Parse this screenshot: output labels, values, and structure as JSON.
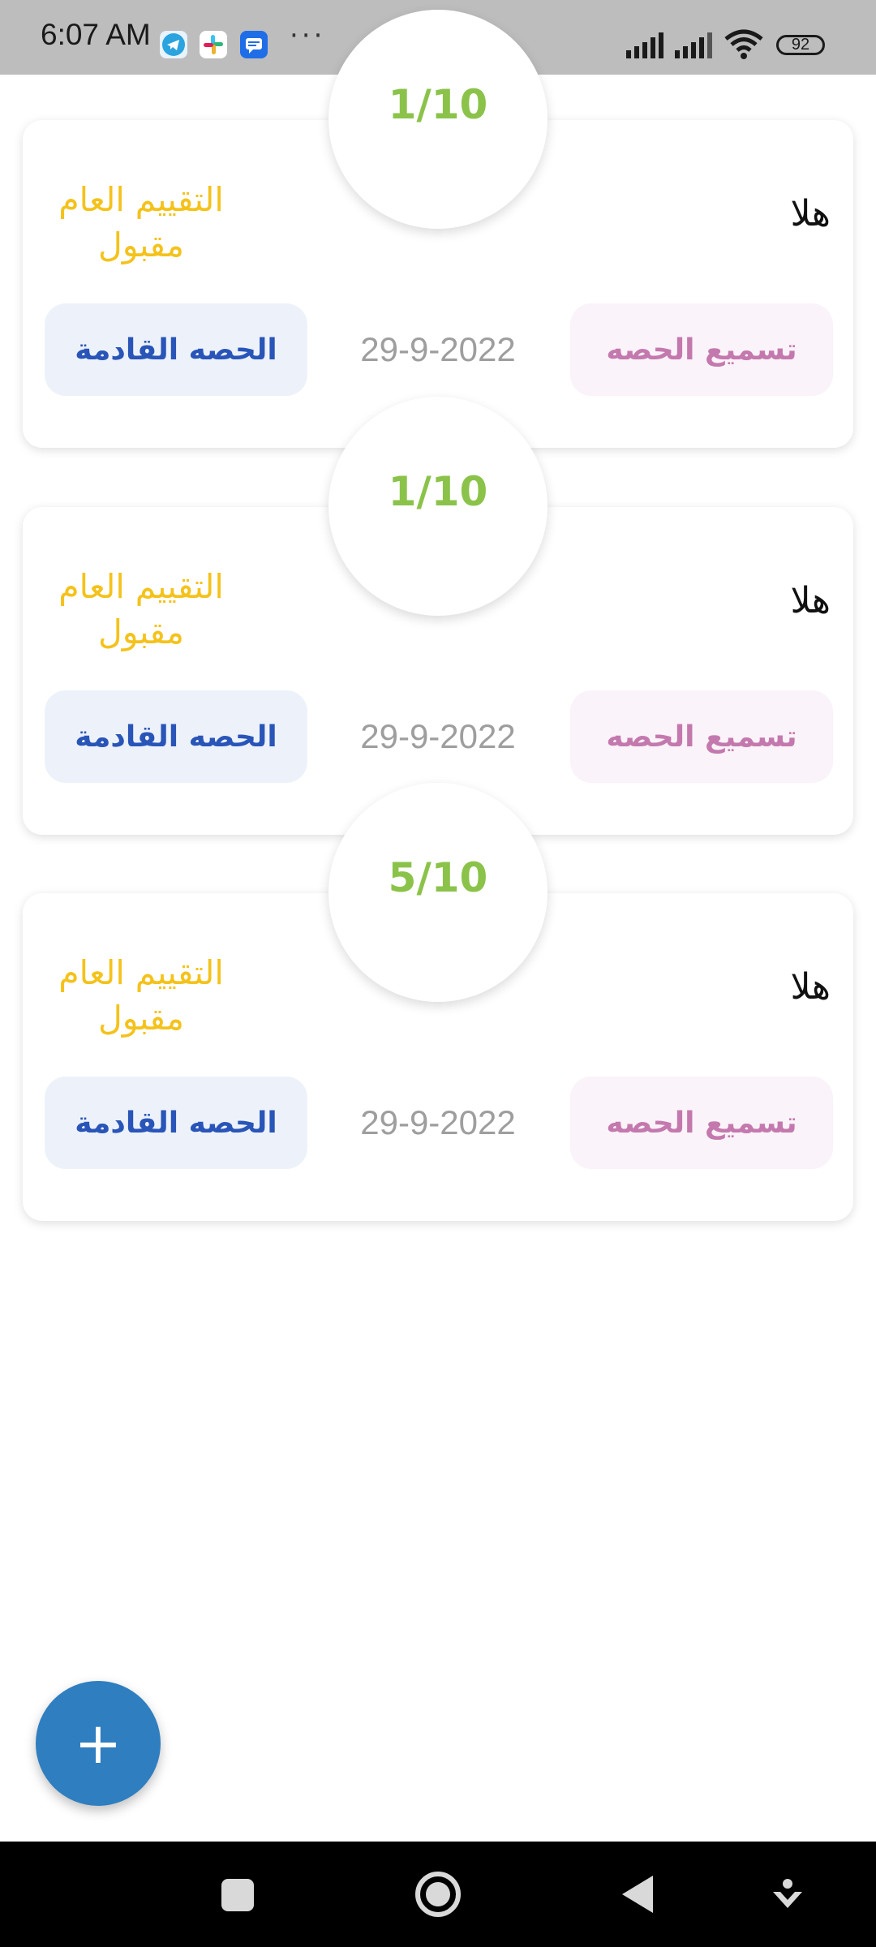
{
  "status_bar": {
    "time": "6:07 AM",
    "battery": "92",
    "notification_icons": [
      "telegram-icon",
      "slack-icon",
      "messages-icon"
    ],
    "more": "···"
  },
  "cards": [
    {
      "score": "1/10",
      "name": "هلا",
      "eval_label": "التقييم العام",
      "eval_value": "مقبول",
      "date": "29-9-2022",
      "next_label": "الحصه القادمة",
      "recite_label": "تسميع الحصه"
    },
    {
      "score": "1/10",
      "name": "هلا",
      "eval_label": "التقييم العام",
      "eval_value": "مقبول",
      "date": "29-9-2022",
      "next_label": "الحصه القادمة",
      "recite_label": "تسميع الحصه"
    },
    {
      "score": "5/10",
      "name": "هلا",
      "eval_label": "التقييم العام",
      "eval_value": "مقبول",
      "date": "29-9-2022",
      "next_label": "الحصه القادمة",
      "recite_label": "تسميع الحصه"
    }
  ],
  "fab": {
    "label": "+"
  },
  "colors": {
    "score": "#8bc34a",
    "eval": "#f4c21b",
    "next_button_text": "#2955b8",
    "recite_button_text": "#c479ae",
    "fab": "#2f7ec0"
  }
}
